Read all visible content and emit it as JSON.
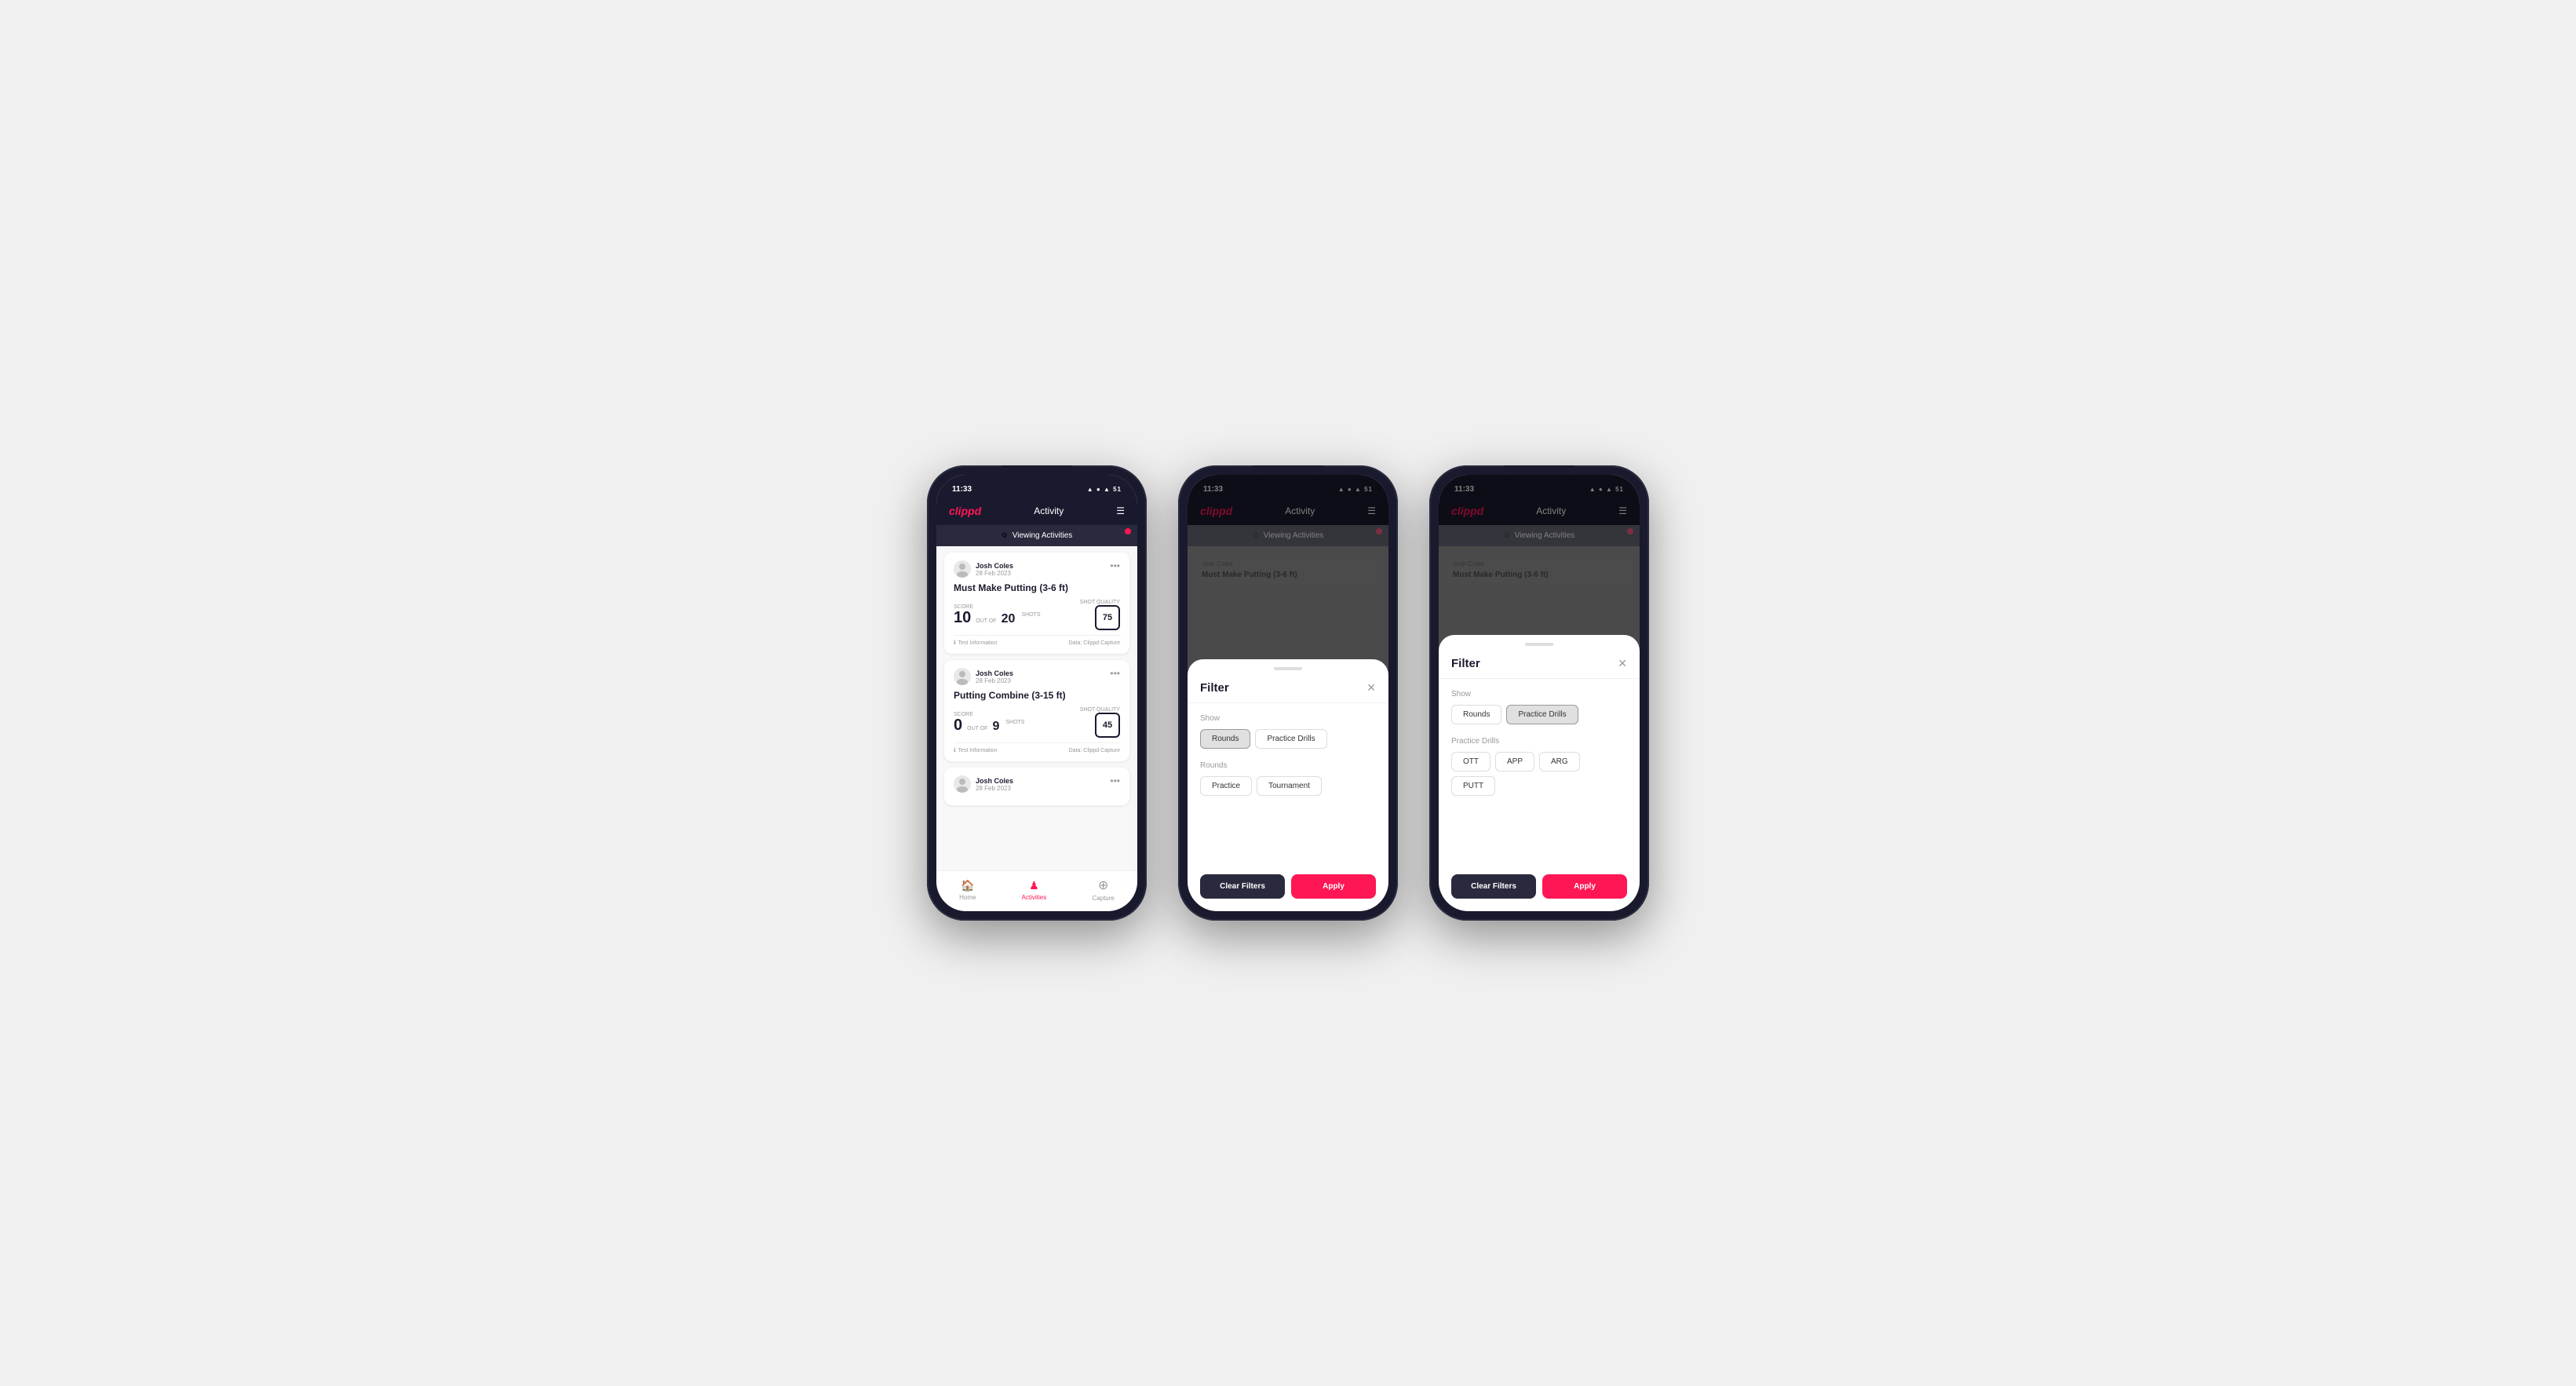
{
  "phones": [
    {
      "id": "phone1",
      "statusBar": {
        "time": "11:33",
        "icons": "▲ ● ▲ 51"
      },
      "header": {
        "logo": "clippd",
        "title": "Activity"
      },
      "viewingBanner": "Viewing Activities",
      "cards": [
        {
          "userName": "Josh Coles",
          "date": "28 Feb 2023",
          "title": "Must Make Putting (3-6 ft)",
          "scorelabel": "Score",
          "shotslabel": "Shots",
          "qualityLabel": "Shot Quality",
          "score": "10",
          "outOf": "OUT OF",
          "shots": "20",
          "quality": "75",
          "info": "Test Information",
          "dataSource": "Data: Clippd Capture"
        },
        {
          "userName": "Josh Coles",
          "date": "28 Feb 2023",
          "title": "Putting Combine (3-15 ft)",
          "scorelabel": "Score",
          "shotslabel": "Shots",
          "qualityLabel": "Shot Quality",
          "score": "0",
          "outOf": "OUT OF",
          "shots": "9",
          "quality": "45",
          "info": "Test Information",
          "dataSource": "Data: Clippd Capture"
        },
        {
          "userName": "Josh Coles",
          "date": "28 Feb 2023",
          "title": "",
          "score": "",
          "shots": "",
          "quality": ""
        }
      ],
      "bottomNav": [
        {
          "icon": "🏠",
          "label": "Home",
          "active": false
        },
        {
          "icon": "♟",
          "label": "Activities",
          "active": true
        },
        {
          "icon": "+",
          "label": "Capture",
          "active": false
        }
      ]
    },
    {
      "id": "phone2",
      "statusBar": {
        "time": "11:33",
        "icons": "▲ ● ▲ 51"
      },
      "header": {
        "logo": "clippd",
        "title": "Activity"
      },
      "viewingBanner": "Viewing Activities",
      "filter": {
        "title": "Filter",
        "show": {
          "label": "Show",
          "options": [
            {
              "label": "Rounds",
              "active": true
            },
            {
              "label": "Practice Drills",
              "active": false
            }
          ]
        },
        "rounds": {
          "label": "Rounds",
          "options": [
            {
              "label": "Practice",
              "active": false
            },
            {
              "label": "Tournament",
              "active": false
            }
          ]
        },
        "clearLabel": "Clear Filters",
        "applyLabel": "Apply"
      }
    },
    {
      "id": "phone3",
      "statusBar": {
        "time": "11:33",
        "icons": "▲ ● ▲ 51"
      },
      "header": {
        "logo": "clippd",
        "title": "Activity"
      },
      "viewingBanner": "Viewing Activities",
      "filter": {
        "title": "Filter",
        "show": {
          "label": "Show",
          "options": [
            {
              "label": "Rounds",
              "active": false
            },
            {
              "label": "Practice Drills",
              "active": true
            }
          ]
        },
        "practiceDrills": {
          "label": "Practice Drills",
          "options": [
            {
              "label": "OTT",
              "active": false
            },
            {
              "label": "APP",
              "active": false
            },
            {
              "label": "ARG",
              "active": false
            },
            {
              "label": "PUTT",
              "active": false
            }
          ]
        },
        "clearLabel": "Clear Filters",
        "applyLabel": "Apply"
      }
    }
  ]
}
